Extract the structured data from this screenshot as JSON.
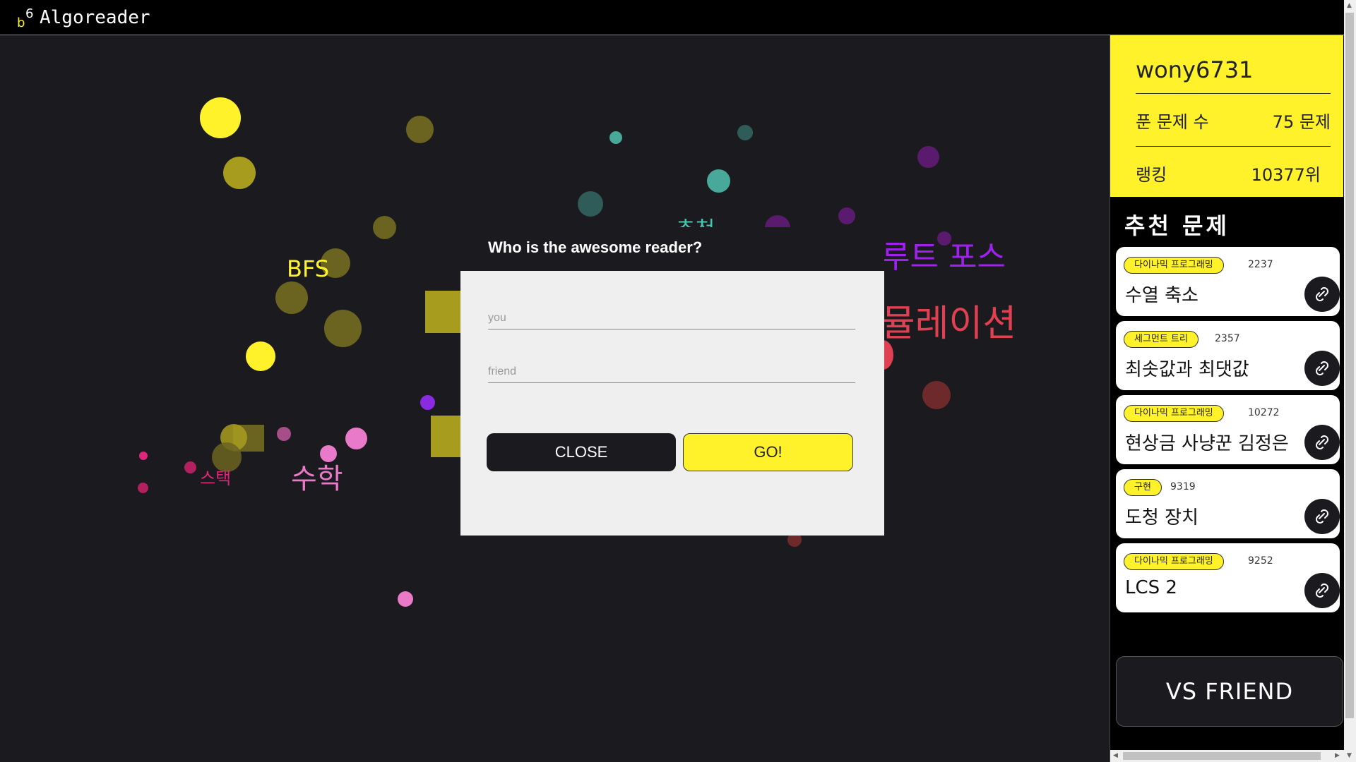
{
  "app": {
    "title": "Algoreader"
  },
  "graph": {
    "labels": [
      {
        "text": "BFS",
        "color": "#fff22a"
      },
      {
        "text": "스택",
        "color": "#e0267a"
      },
      {
        "text": "수학",
        "color": "#e87ac9"
      },
      {
        "text": "루트 포스",
        "color": "#a020f0"
      },
      {
        "text": "시뮬레이션",
        "color": "#e04052"
      },
      {
        "text": "추천",
        "color": "#48c4b0"
      }
    ]
  },
  "profile": {
    "username": "wony6731",
    "solved_label": "푼 문제 수",
    "solved_value": "75 문제",
    "rank_label": "랭킹",
    "rank_value": "10377위"
  },
  "recommend": {
    "title": "추천 문제",
    "items": [
      {
        "tag": "다이나믹 프로그래밍",
        "id": "2237",
        "name": "수열 축소"
      },
      {
        "tag": "세그먼트 트리",
        "id": "2357",
        "name": "최솟값과 최댓값"
      },
      {
        "tag": "다이나믹 프로그래밍",
        "id": "10272",
        "name": "현상금 사냥꾼 김정은"
      },
      {
        "tag": "구현",
        "id": "9319",
        "name": "도청 장치"
      },
      {
        "tag": "다이나믹 프로그래밍",
        "id": "9252",
        "name": "LCS 2"
      }
    ],
    "link_icon": "link-icon"
  },
  "vs_button": "VS FRIEND",
  "modal": {
    "title": "Who is the awesome reader?",
    "you_placeholder": "you",
    "friend_placeholder": "friend",
    "close_label": "CLOSE",
    "go_label": "GO!"
  },
  "colors": {
    "accent": "#fff22a",
    "background": "#1b1b1f",
    "panel": "#000000"
  }
}
